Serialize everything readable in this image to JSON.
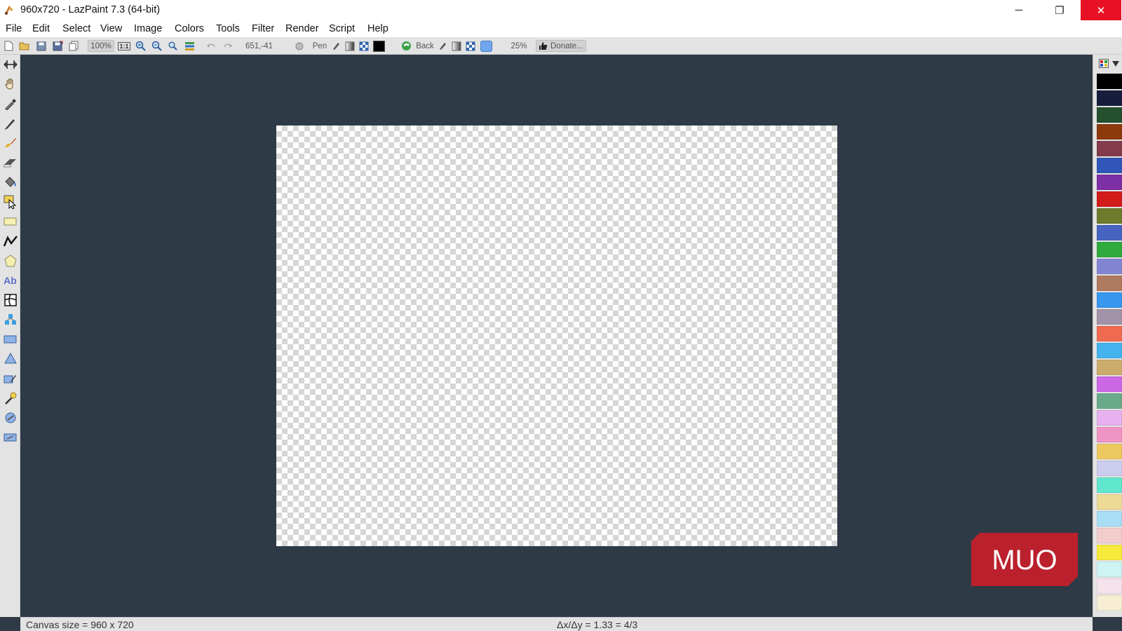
{
  "window": {
    "title": "960x720 - LazPaint 7.3 (64-bit)",
    "minimize_glyph": "─",
    "restore_glyph": "❐",
    "close_glyph": "✕"
  },
  "menu": {
    "items": [
      "File",
      "Edit",
      "Select",
      "View",
      "Image",
      "Colors",
      "Tools",
      "Filter",
      "Render",
      "Script",
      "Help"
    ]
  },
  "toolbar": {
    "zoom_level": "100%",
    "actual_size_label": "1:1",
    "cursor_position": "651,-41",
    "tool_name": "Pen",
    "back_label": "Back",
    "opacity": "25%",
    "donate_label": "Donate..."
  },
  "tools": [
    {
      "name": "move-selection-icon"
    },
    {
      "name": "hand-icon"
    },
    {
      "name": "color-picker-icon"
    },
    {
      "name": "pen-icon"
    },
    {
      "name": "brush-icon"
    },
    {
      "name": "eraser-icon"
    },
    {
      "name": "paint-bucket-icon"
    },
    {
      "name": "edit-shape-icon"
    },
    {
      "name": "rectangle-icon"
    },
    {
      "name": "polyline-icon"
    },
    {
      "name": "polygon-icon"
    },
    {
      "name": "text-icon",
      "glyph": "Ab"
    },
    {
      "name": "deformation-grid-icon"
    },
    {
      "name": "clone-icon"
    },
    {
      "name": "select-rectangle-icon"
    },
    {
      "name": "select-polygon-icon"
    },
    {
      "name": "select-pen-icon"
    },
    {
      "name": "magic-wand-icon"
    },
    {
      "name": "select-ellipse-icon"
    },
    {
      "name": "select-layer-icon"
    }
  ],
  "palette": {
    "colors": [
      "#000000",
      "#171d3c",
      "#24502e",
      "#8c3a0c",
      "#843c4c",
      "#2f56b8",
      "#7d2fa5",
      "#d21c1c",
      "#6e7a2c",
      "#4664c0",
      "#2faa3c",
      "#8286d2",
      "#b07a5e",
      "#3796ee",
      "#a393a9",
      "#ef6a50",
      "#44b3ee",
      "#ccac6c",
      "#cb68e6",
      "#6aaa8a",
      "#e7b0ee",
      "#f094c6",
      "#ecc85e",
      "#cccdee",
      "#60e6cc",
      "#ecda96",
      "#a8ddf4",
      "#f3cccc",
      "#f6ea3a",
      "#cdf4f2",
      "#f6e2ea",
      "#f7eed4"
    ]
  },
  "status": {
    "canvas_size": "Canvas size = 960 x 720",
    "ratio": "Δx/Δy = 1.33 = 4/3"
  },
  "watermark": {
    "text": "MUO"
  },
  "colors": {
    "workspace": "#2e3a46",
    "close_button": "#e81123",
    "watermark_red": "#c8202a"
  }
}
